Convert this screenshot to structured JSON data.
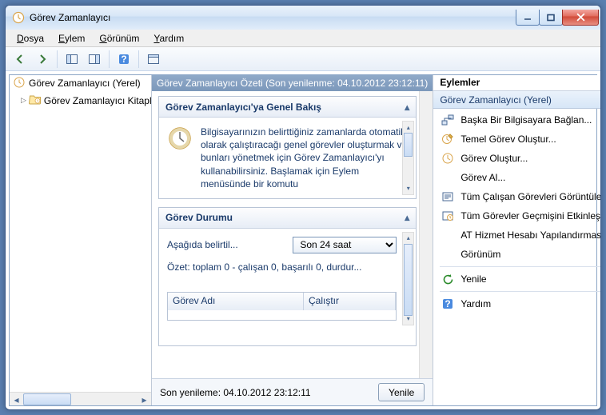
{
  "window": {
    "title": "Görev Zamanlayıcı"
  },
  "menu": {
    "file": "Dosya",
    "action": "Eylem",
    "view": "Görünüm",
    "help": "Yardım"
  },
  "tree": {
    "root": "Görev Zamanlayıcı (Yerel)",
    "lib": "Görev Zamanlayıcı Kitaplığı"
  },
  "mid": {
    "header": "Görev Zamanlayıcı Özeti (Son yenilenme: 04.10.2012 23:12:11)",
    "overview_title": "Görev Zamanlayıcı'ya Genel Bakış",
    "overview_text": "Bilgisayarınızın belirttiğiniz zamanlarda otomatik olarak çalıştıracağı genel görevler oluşturmak ve bunları yönetmek için Görev Zamanlayıcı'yı kullanabilirsiniz. Başlamak için Eylem menüsünde bir komutu",
    "status_title": "Görev Durumu",
    "status_label": "Aşağıda belirtil...",
    "status_select": "Son 24 saat",
    "summary": "Özet: toplam 0 - çalışan 0, başarılı 0, durdur...",
    "col_name": "Görev Adı",
    "col_run": "Çalıştır",
    "footer_text": "Son yenileme: 04.10.2012 23:12:11",
    "refresh_btn": "Yenile"
  },
  "actions": {
    "title": "Eylemler",
    "group": "Görev Zamanlayıcı (Yerel)",
    "items": [
      {
        "icon": "connect",
        "label": "Başka Bir Bilgisayara Bağlan..."
      },
      {
        "icon": "basic",
        "label": "Temel Görev Oluştur..."
      },
      {
        "icon": "create",
        "label": "Görev Oluştur..."
      },
      {
        "icon": "import",
        "label": "Görev Al..."
      },
      {
        "icon": "running",
        "label": "Tüm Çalışan Görevleri Görüntüle"
      },
      {
        "icon": "history",
        "label": "Tüm Görevler Geçmişini Etkinleştir"
      },
      {
        "icon": "at",
        "label": "AT Hizmet Hesabı Yapılandırması"
      },
      {
        "icon": "view",
        "label": "Görünüm",
        "submenu": true
      },
      {
        "icon": "sep"
      },
      {
        "icon": "refresh",
        "label": "Yenile"
      },
      {
        "icon": "sep"
      },
      {
        "icon": "help",
        "label": "Yardım"
      }
    ]
  }
}
